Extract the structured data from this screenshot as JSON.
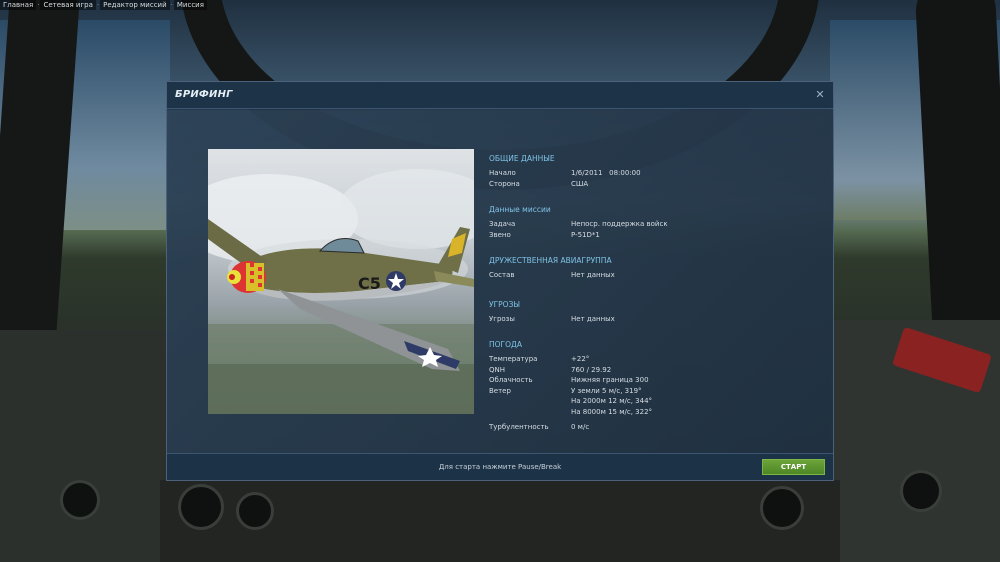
{
  "breadcrumb": [
    "Главная",
    "Сетевая игра",
    "Редактор миссий",
    "Миссия"
  ],
  "dialog": {
    "title": "БРИФИНГ",
    "close_icon": "close-icon"
  },
  "image": {
    "description_icon": "aircraft-image",
    "tail_code": "C5"
  },
  "sections": {
    "general": {
      "title": "ОБЩИЕ ДАННЫЕ",
      "start_label": "Начало",
      "start_value": "1/6/2011   08:00:00",
      "side_label": "Сторона",
      "side_value": "США"
    },
    "mission": {
      "title": "Данные миссии",
      "task_label": "Задача",
      "task_value": "Непоср. поддержка войск",
      "flight_label": "Звено",
      "flight_value": "P-51D*1"
    },
    "friendly": {
      "title": "ДРУЖЕСТВЕННАЯ АВИАГРУППА",
      "composition_label": "Состав",
      "composition_value": "Нет данных"
    },
    "threats": {
      "title": "УГРОЗЫ",
      "threats_label": "Угрозы",
      "threats_value": "Нет данных"
    },
    "weather": {
      "title": "ПОГОДА",
      "temp_label": "Температура",
      "temp_value": "+22°",
      "qnh_label": "QNH",
      "qnh_value": "760 / 29.92",
      "cloud_label": "Облачность",
      "cloud_value": "Нижняя граница 300",
      "wind_label": "Ветер",
      "wind_ground": "У земли 5 м/с, 319°",
      "wind_2000": "На 2000м 12 м/с, 344°",
      "wind_8000": "На 8000м 15 м/с, 322°",
      "turb_label": "Турбулентность",
      "turb_value": "0 м/с"
    }
  },
  "footer": {
    "hint": "Для старта нажмите Pause/Break",
    "start_label": "СТАРТ"
  },
  "colors": {
    "section_title": "#7fc3e6",
    "start_button": "#5a962e",
    "dialog_bg": "#223446"
  }
}
